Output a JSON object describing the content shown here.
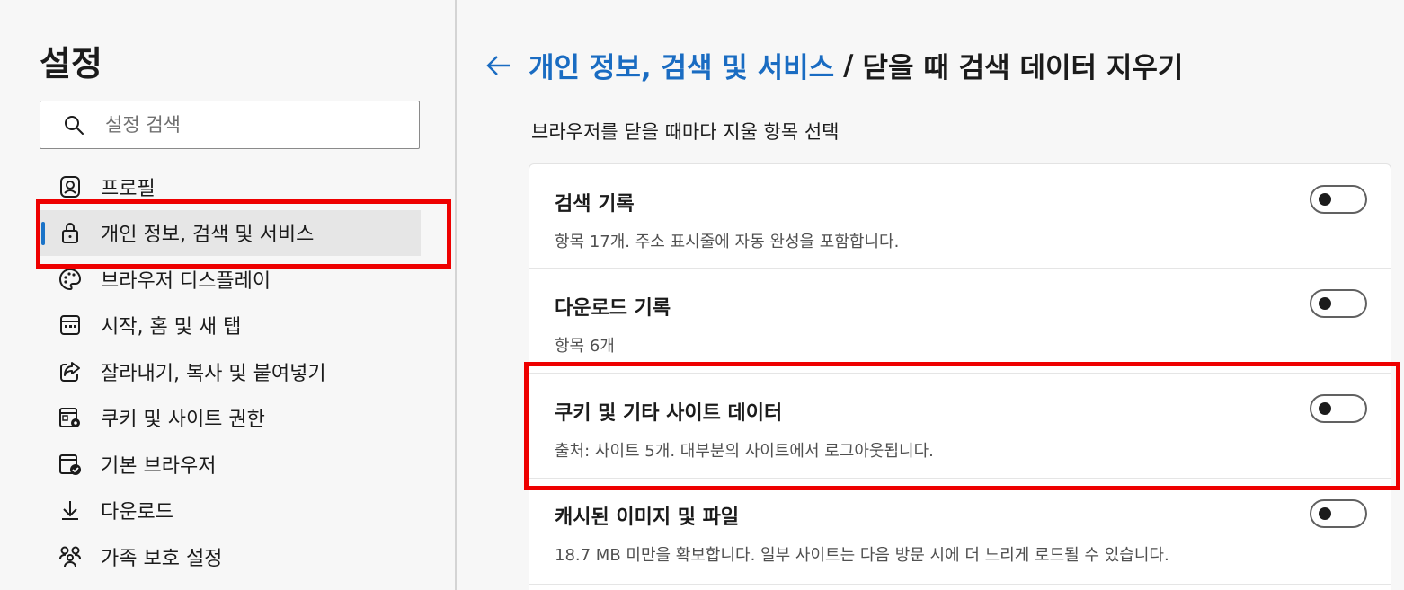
{
  "sidebar": {
    "title": "설정",
    "search_placeholder": "설정 검색",
    "items": [
      {
        "label": "프로필",
        "icon": "profile-icon"
      },
      {
        "label": "개인 정보, 검색 및 서비스",
        "icon": "lock-icon",
        "active": true
      },
      {
        "label": "브라우저 디스플레이",
        "icon": "palette-icon"
      },
      {
        "label": "시작, 홈 및 새 탭",
        "icon": "start-home-icon"
      },
      {
        "label": "잘라내기, 복사 및 붙여넣기",
        "icon": "share-icon"
      },
      {
        "label": "쿠키 및 사이트 권한",
        "icon": "site-permissions-icon"
      },
      {
        "label": "기본 브라우저",
        "icon": "default-browser-icon"
      },
      {
        "label": "다운로드",
        "icon": "download-icon"
      },
      {
        "label": "가족 보호 설정",
        "icon": "family-icon"
      }
    ]
  },
  "header": {
    "breadcrumb_link": "개인 정보, 검색 및 서비스",
    "separator": "/",
    "current": "닫을 때 검색 데이터 지우기"
  },
  "main": {
    "subtitle": "브라우저를 닫을 때마다 지울 항목 선택",
    "rows": [
      {
        "title": "검색 기록",
        "description": "항목 17개. 주소 표시줄에 자동 완성을 포함합니다.",
        "enabled": false
      },
      {
        "title": "다운로드 기록",
        "description": "항목 6개",
        "enabled": false
      },
      {
        "title": "쿠키 및 기타 사이트 데이터",
        "description": "출처: 사이트 5개. 대부분의 사이트에서 로그아웃됩니다.",
        "enabled": false
      },
      {
        "title": "캐시된 이미지 및 파일",
        "description": "18.7 MB 미만을 확보합니다. 일부 사이트는 다음 방문 시에 더 느리게 로드될 수 있습니다.",
        "enabled": false
      }
    ]
  },
  "colors": {
    "accent": "#1a6cc2",
    "highlight": "#ee0000",
    "active_indicator": "#1a73c8"
  }
}
